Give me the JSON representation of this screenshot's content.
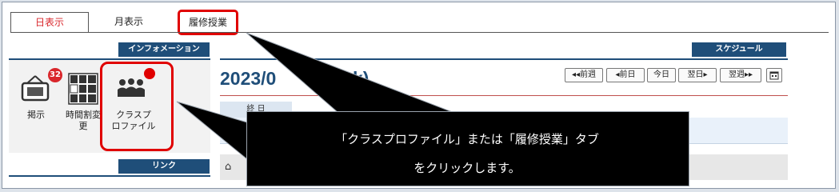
{
  "tabs": [
    {
      "label": "日表示"
    },
    {
      "label": "月表示"
    },
    {
      "label": "履修授業"
    }
  ],
  "info": {
    "header": "インフォメーション",
    "apps": [
      {
        "label": "掲示",
        "badge": "32"
      },
      {
        "label": "時間割変\n更"
      },
      {
        "label": "クラスプ\nロファイル"
      }
    ],
    "link_header": "リンク"
  },
  "schedule": {
    "header": "スケジュール",
    "date_start": "2023/0",
    "date_end": "k)",
    "nav": [
      "◂◂前週",
      "◂前日",
      "今日",
      "翌日▸",
      "翌週▸▸"
    ],
    "day_label": "終 日"
  },
  "callout": {
    "line1": "「クラスプロファイル」または「履修授業」タブ",
    "line2": "をクリックします。"
  },
  "colors": {
    "accent": "#1f4e79",
    "highlight": "#e00000",
    "badge": "#d9262b"
  }
}
